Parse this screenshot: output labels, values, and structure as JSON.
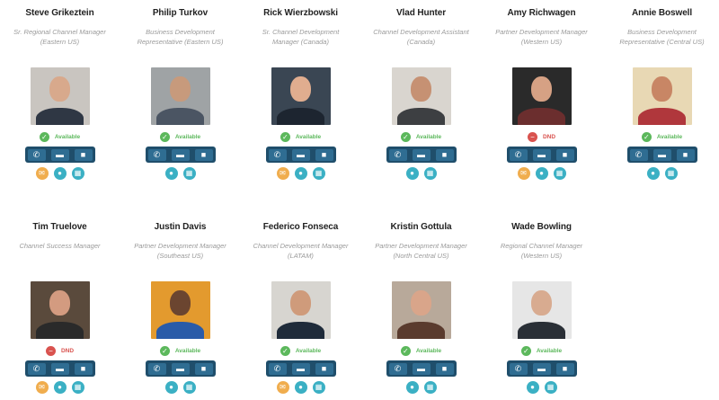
{
  "directory": {
    "people": [
      {
        "name": "Steve Grikeztein",
        "role": "Sr. Regional Channel Manager (Eastern US)",
        "status": "Available",
        "status_type": "ok",
        "social": [
          "orange",
          "teal",
          "teal"
        ],
        "photo": {
          "bg": "#c9c5c0",
          "skin": "#d8a98c",
          "shirt": "#2f3744"
        }
      },
      {
        "name": "Philip Turkov",
        "role": "Business Development Representative (Eastern US)",
        "status": "Available",
        "status_type": "ok",
        "social": [
          "teal",
          "teal"
        ],
        "photo": {
          "bg": "#9fa3a5",
          "skin": "#c79a7c",
          "shirt": "#4b5563"
        }
      },
      {
        "name": "Rick Wierzbowski",
        "role": "Sr. Channel Development Manager (Canada)",
        "status": "Available",
        "status_type": "ok",
        "social": [
          "orange",
          "teal",
          "teal"
        ],
        "photo": {
          "bg": "#3a4653",
          "skin": "#e0ad8f",
          "shirt": "#1d2530"
        }
      },
      {
        "name": "Vlad Hunter",
        "role": "Channel Development Assistant (Canada)",
        "status": "Available",
        "status_type": "ok",
        "social": [
          "teal",
          "teal"
        ],
        "photo": {
          "bg": "#d9d5cf",
          "skin": "#c69173",
          "shirt": "#3d3f42"
        }
      },
      {
        "name": "Amy Richwagen",
        "role": "Partner Development Manager (Western US)",
        "status": "DND",
        "status_type": "dnd",
        "social": [
          "orange",
          "teal",
          "teal"
        ],
        "photo": {
          "bg": "#2a2a2a",
          "skin": "#d6a184",
          "shirt": "#6b2e2e"
        }
      },
      {
        "name": "Annie Boswell",
        "role": "Business Development Representative (Central US)",
        "status": "Available",
        "status_type": "ok",
        "social": [
          "teal",
          "teal"
        ],
        "photo": {
          "bg": "#e8d8b4",
          "skin": "#c88665",
          "shirt": "#b0373c"
        }
      },
      {
        "name": "Tim Truelove",
        "role": "Channel Success Manager",
        "status": "DND",
        "status_type": "dnd",
        "social": [
          "orange",
          "teal",
          "teal"
        ],
        "photo": {
          "bg": "#5a4a3c",
          "skin": "#d39b80",
          "shirt": "#2a2a2a"
        }
      },
      {
        "name": "Justin Davis",
        "role": "Partner Development Manager (Southeast US)",
        "status": "Available",
        "status_type": "ok",
        "social": [
          "teal",
          "teal"
        ],
        "photo": {
          "bg": "#e39a2e",
          "skin": "#6b4530",
          "shirt": "#2a5ba8"
        }
      },
      {
        "name": "Federico Fonseca",
        "role": "Channel Development Manager (LATAM)",
        "status": "Available",
        "status_type": "ok",
        "social": [
          "orange",
          "teal",
          "teal"
        ],
        "photo": {
          "bg": "#d7d5d0",
          "skin": "#cf9b7b",
          "shirt": "#1f2b3a"
        }
      },
      {
        "name": "Kristin Gottula",
        "role": "Partner Development Manager (North Central US)",
        "status": "Available",
        "status_type": "ok",
        "social": [
          "teal",
          "teal"
        ],
        "photo": {
          "bg": "#b8a99a",
          "skin": "#d9a58a",
          "shirt": "#5a3b2e"
        }
      },
      {
        "name": "Wade Bowling",
        "role": "Regional Channel Manager (Western US)",
        "status": "Available",
        "status_type": "ok",
        "social": [
          "teal",
          "teal"
        ],
        "photo": {
          "bg": "#e6e6e6",
          "skin": "#d8ab90",
          "shirt": "#2a2f36"
        }
      }
    ],
    "actions": {
      "phone_icon": "phone-icon",
      "chat_icon": "chat-icon",
      "video_icon": "video-icon"
    },
    "colors": {
      "available": "#5cb85c",
      "dnd": "#d9534f",
      "action_bar": "#1f4e6b",
      "social_orange": "#f0ad4e",
      "social_teal": "#3bb0c4"
    }
  }
}
